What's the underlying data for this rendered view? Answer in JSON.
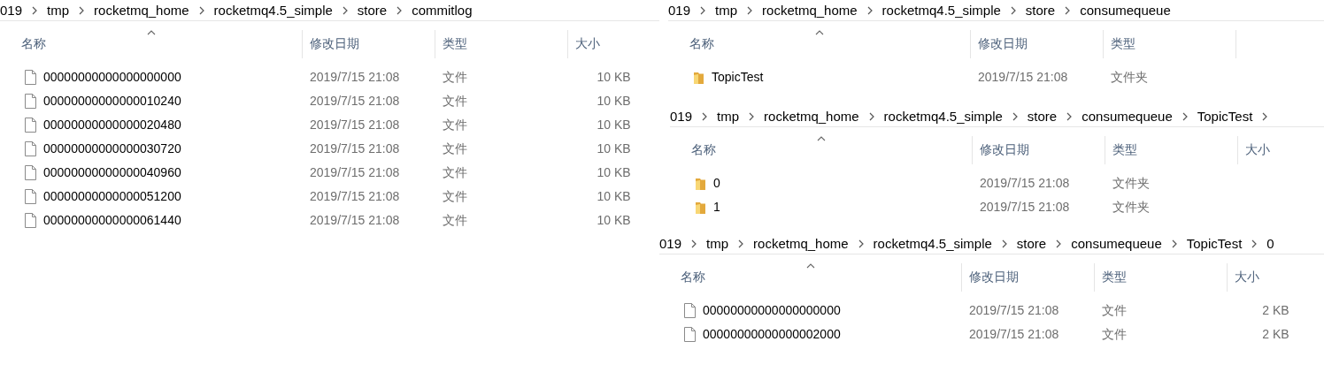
{
  "panels": [
    {
      "breadcrumb": [
        "019",
        "tmp",
        "rocketmq_home",
        "rocketmq4.5_simple",
        "store",
        "commitlog"
      ],
      "columns": [
        "名称",
        "修改日期",
        "类型",
        "大小"
      ],
      "rows": [
        {
          "kind": "file",
          "name": "00000000000000000000",
          "date": "2019/7/15 21:08",
          "type": "文件",
          "size": "10 KB"
        },
        {
          "kind": "file",
          "name": "00000000000000010240",
          "date": "2019/7/15 21:08",
          "type": "文件",
          "size": "10 KB"
        },
        {
          "kind": "file",
          "name": "00000000000000020480",
          "date": "2019/7/15 21:08",
          "type": "文件",
          "size": "10 KB"
        },
        {
          "kind": "file",
          "name": "00000000000000030720",
          "date": "2019/7/15 21:08",
          "type": "文件",
          "size": "10 KB"
        },
        {
          "kind": "file",
          "name": "00000000000000040960",
          "date": "2019/7/15 21:08",
          "type": "文件",
          "size": "10 KB"
        },
        {
          "kind": "file",
          "name": "00000000000000051200",
          "date": "2019/7/15 21:08",
          "type": "文件",
          "size": "10 KB"
        },
        {
          "kind": "file",
          "name": "00000000000000061440",
          "date": "2019/7/15 21:08",
          "type": "文件",
          "size": "10 KB"
        }
      ]
    },
    {
      "breadcrumb": [
        "019",
        "tmp",
        "rocketmq_home",
        "rocketmq4.5_simple",
        "store",
        "consumequeue"
      ],
      "columns": [
        "名称",
        "修改日期",
        "类型"
      ],
      "rows": [
        {
          "kind": "folder",
          "name": "TopicTest",
          "date": "2019/7/15 21:08",
          "type": "文件夹"
        }
      ]
    },
    {
      "breadcrumb": [
        "019",
        "tmp",
        "rocketmq_home",
        "rocketmq4.5_simple",
        "store",
        "consumequeue",
        "TopicTest"
      ],
      "trailing_separator": true,
      "columns": [
        "名称",
        "修改日期",
        "类型",
        "大小"
      ],
      "rows": [
        {
          "kind": "folder",
          "name": "0",
          "date": "2019/7/15 21:08",
          "type": "文件夹"
        },
        {
          "kind": "folder",
          "name": "1",
          "date": "2019/7/15 21:08",
          "type": "文件夹"
        }
      ]
    },
    {
      "breadcrumb": [
        "019",
        "tmp",
        "rocketmq_home",
        "rocketmq4.5_simple",
        "store",
        "consumequeue",
        "TopicTest",
        "0"
      ],
      "columns": [
        "名称",
        "修改日期",
        "类型",
        "大小"
      ],
      "rows": [
        {
          "kind": "file",
          "name": "00000000000000000000",
          "date": "2019/7/15 21:08",
          "type": "文件",
          "size": "2 KB"
        },
        {
          "kind": "file",
          "name": "00000000000000002000",
          "date": "2019/7/15 21:08",
          "type": "文件",
          "size": "2 KB"
        }
      ]
    }
  ]
}
